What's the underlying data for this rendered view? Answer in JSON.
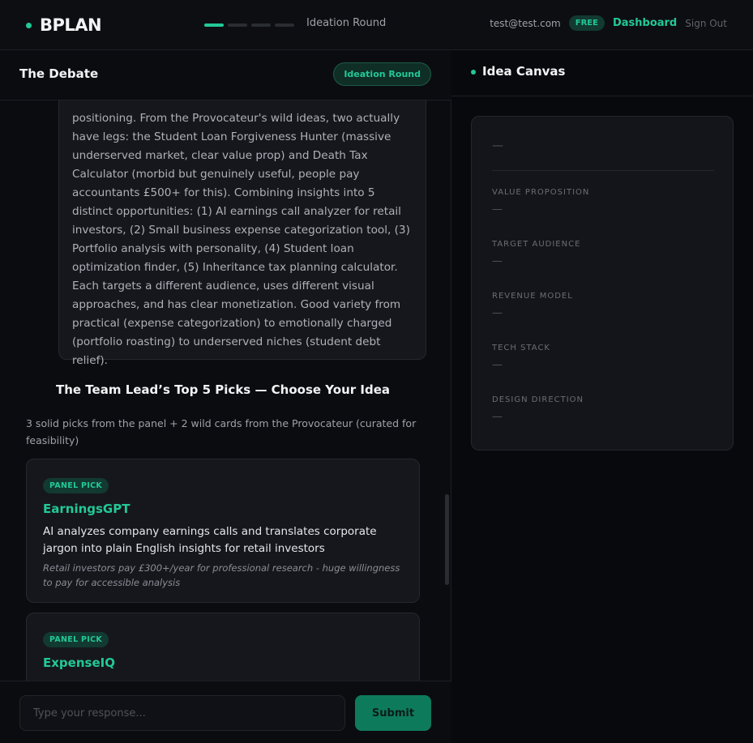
{
  "header": {
    "brand": "BPLAN",
    "progress_steps": [
      true,
      false,
      false,
      false
    ],
    "round_label": "Ideation Round",
    "user_email": "test@test.com",
    "plan_badge": "FREE",
    "dashboard_link": "Dashboard",
    "signout_link": "Sign Out"
  },
  "debate": {
    "title": "The Debate",
    "round_chip": "Ideation Round",
    "message_text": "positioning. From the Provocateur's wild ideas, two actually have legs: the Student Loan Forgiveness Hunter (massive underserved market, clear value prop) and Death Tax Calculator (morbid but genuinely useful, people pay accountants £500+ for this). Combining insights into 5 distinct opportunities: (1) AI earnings call analyzer for retail investors, (2) Small business expense categorization tool, (3) Portfolio analysis with personality, (4) Student loan optimization finder, (5) Inheritance tax planning calculator. Each targets a different audience, uses different visual approaches, and has clear monetization. Good variety from practical (expense categorization) to emotionally charged (portfolio roasting) to underserved niches (student debt relief).",
    "picks_title": "The Team Lead’s Top 5 Picks — Choose Your Idea",
    "picks_subtitle": "3 solid picks from the panel + 2 wild cards from the Provocateur (curated for feasibility)",
    "picks": [
      {
        "badge": "PANEL PICK",
        "name": "EarningsGPT",
        "description": "AI analyzes company earnings calls and translates corporate jargon into plain English insights for retail investors",
        "note": "Retail investors pay £300+/year for professional research - huge willingness to pay for accessible analysis"
      },
      {
        "badge": "PANEL PICK",
        "name": "ExpenseIQ",
        "description": "",
        "note": ""
      }
    ],
    "input_placeholder": "Type your response...",
    "submit_label": "Submit"
  },
  "canvas": {
    "title": "Idea Canvas",
    "idea_name": "—",
    "fields": [
      {
        "label": "VALUE PROPOSITION",
        "value": "—"
      },
      {
        "label": "TARGET AUDIENCE",
        "value": "—"
      },
      {
        "label": "REVENUE MODEL",
        "value": "—"
      },
      {
        "label": "TECH STACK",
        "value": "—"
      },
      {
        "label": "DESIGN DIRECTION",
        "value": "—"
      }
    ]
  },
  "colors": {
    "accent": "#22c997",
    "background": "#0b0c10",
    "card": "#16171d"
  }
}
